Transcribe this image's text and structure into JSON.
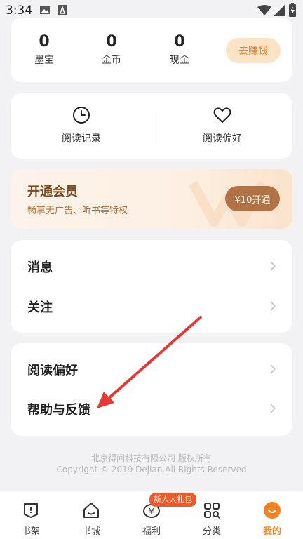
{
  "status_bar": {
    "time": "3:34"
  },
  "wallet": {
    "stats": [
      {
        "value": "0",
        "label": "墨宝"
      },
      {
        "value": "0",
        "label": "金币"
      },
      {
        "value": "0",
        "label": "现金"
      }
    ],
    "earn_button": "去赚钱"
  },
  "shortcuts": [
    {
      "label": "阅读记录",
      "icon": "clock-icon"
    },
    {
      "label": "阅读偏好",
      "icon": "heart-icon"
    }
  ],
  "vip": {
    "title": "开通会员",
    "subtitle": "畅享无广告、听书等特权",
    "button": "¥10开通"
  },
  "menu_group_1": [
    {
      "label": "消息"
    },
    {
      "label": "关注"
    }
  ],
  "menu_group_2": [
    {
      "label": "阅读偏好"
    },
    {
      "label": "帮助与反馈"
    }
  ],
  "footer": {
    "line1": "北京得间科技有限公司 版权所有",
    "line2": "Copyright © 2019 Dejian.All Rights Reserved"
  },
  "tabbar": {
    "badge": "新人大礼包",
    "tabs": [
      {
        "label": "书架",
        "icon": "bookshelf-icon"
      },
      {
        "label": "书城",
        "icon": "bookstore-icon"
      },
      {
        "label": "福利",
        "icon": "welfare-icon"
      },
      {
        "label": "分类",
        "icon": "category-icon"
      },
      {
        "label": "我的",
        "icon": "profile-icon"
      }
    ],
    "active_tab": "我的"
  },
  "colors": {
    "accent": "#f08a24",
    "vip_button": "#b37246",
    "arrow": "#e53935"
  }
}
